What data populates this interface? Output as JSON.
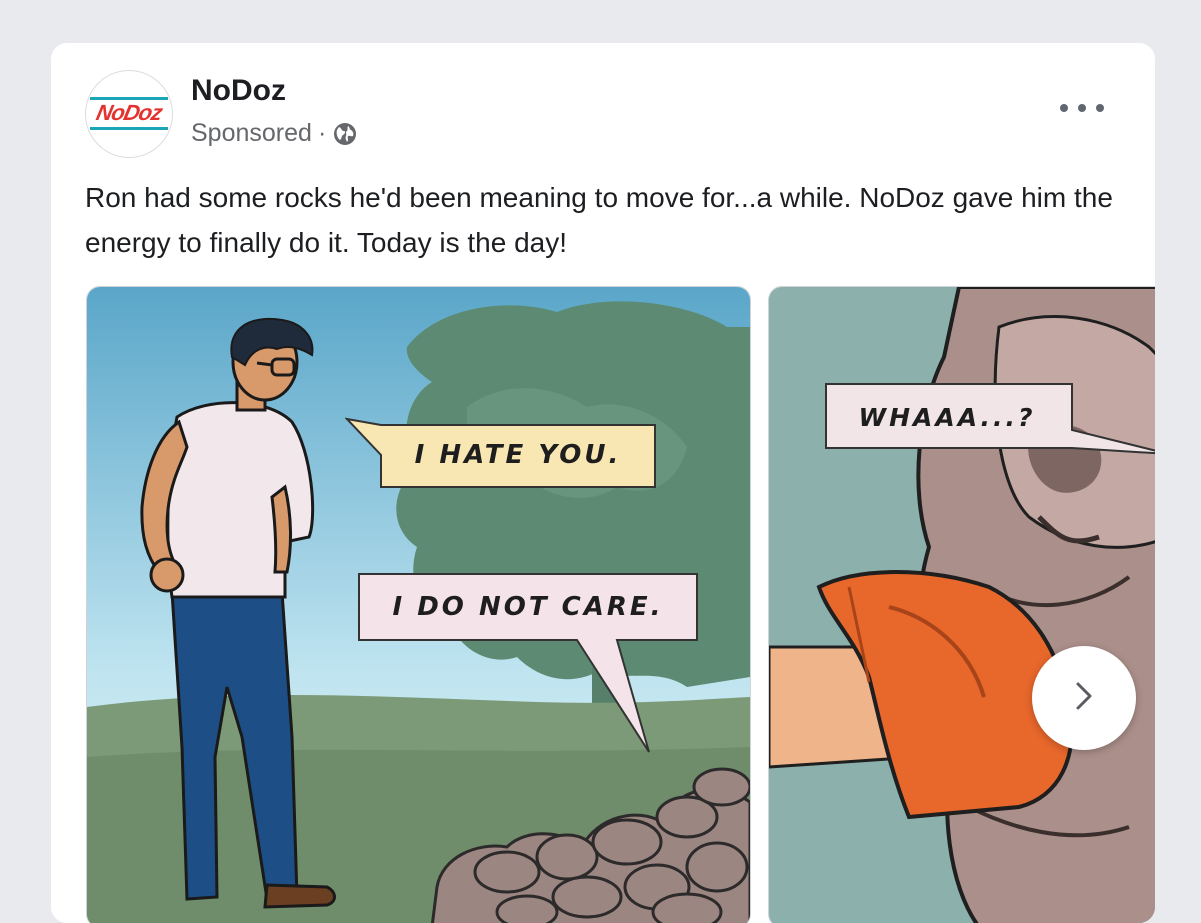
{
  "post": {
    "page_name": "NoDoz",
    "logo_text": "NoDoz",
    "sponsored_label": "Sponsored",
    "separator": "·",
    "text": "Ron had some rocks he'd been meaning to move for...a while. NoDoz gave him the energy to finally do it. Today is the day!"
  },
  "carousel": {
    "slides": [
      {
        "bubbles": [
          "I HATE YOU.",
          "I DO NOT CARE."
        ]
      },
      {
        "bubbles": [
          "WHAAA...?"
        ]
      }
    ]
  },
  "icons": {
    "globe": "globe-icon",
    "more": "more-options-icon",
    "next": "chevron-right-icon"
  },
  "colors": {
    "page_background": "#e9eaee",
    "card_background": "#ffffff",
    "text_primary": "#1c1e21",
    "text_secondary": "#65676b",
    "brand_red": "#e4332f",
    "brand_teal": "#1aa6b7"
  }
}
